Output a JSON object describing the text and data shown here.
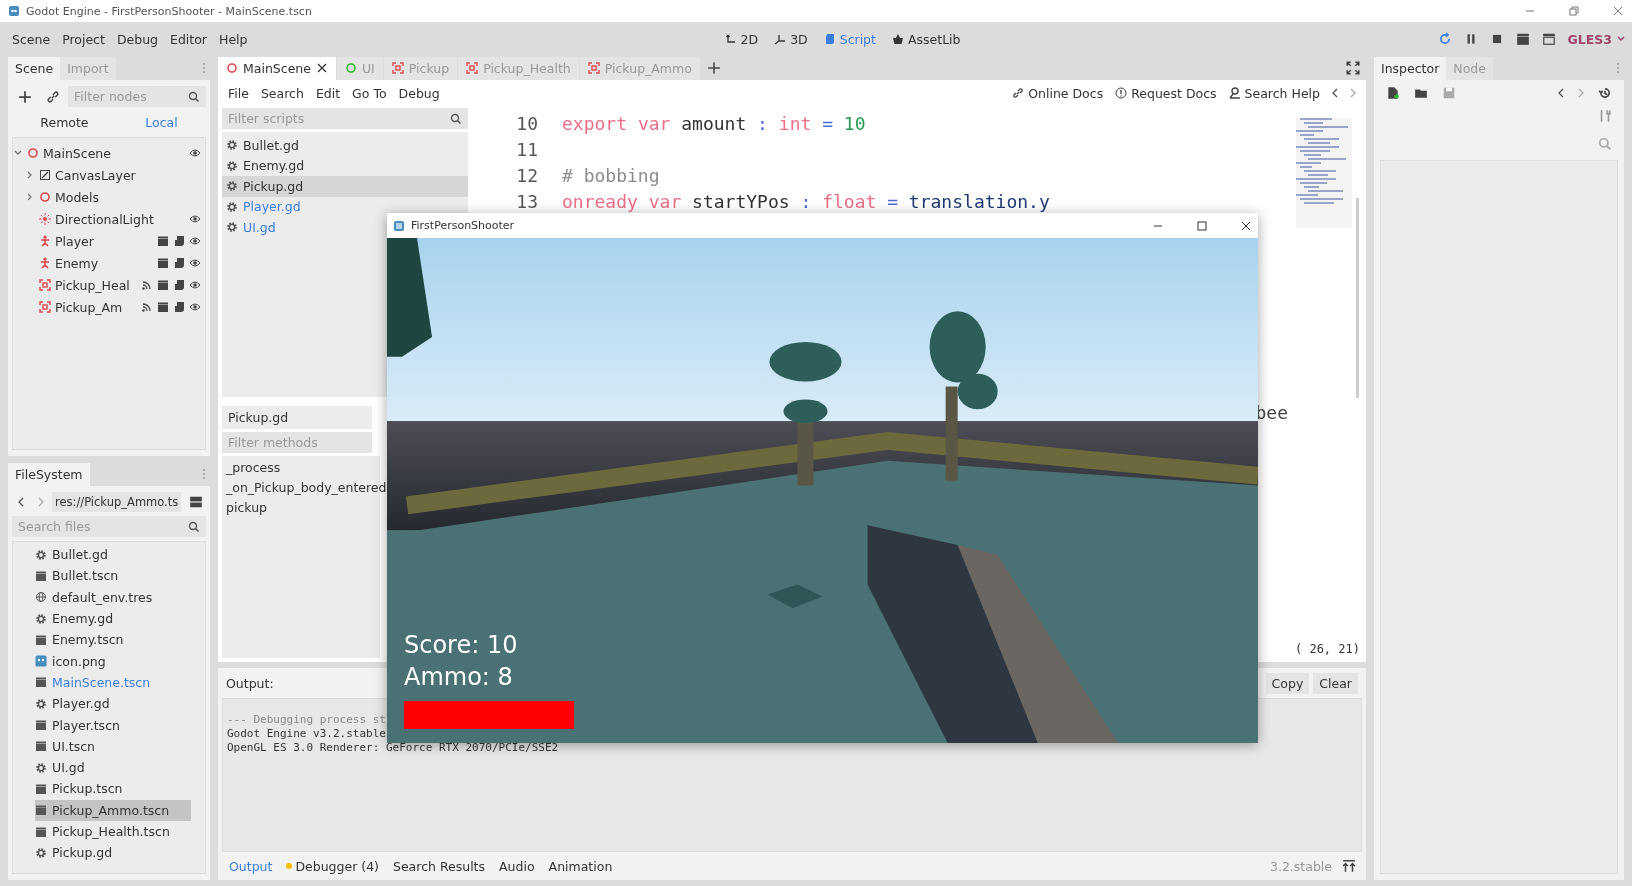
{
  "window": {
    "title": "Godot Engine - FirstPersonShooter - MainScene.tscn"
  },
  "menu": [
    "Scene",
    "Project",
    "Debug",
    "Editor",
    "Help"
  ],
  "workspaces": [
    {
      "label": "2D",
      "kind": "planar",
      "selected": false
    },
    {
      "label": "3D",
      "kind": "spatial",
      "selected": false
    },
    {
      "label": "Script",
      "kind": "script",
      "selected": true
    },
    {
      "label": "AssetLib",
      "kind": "assetlib",
      "selected": false
    }
  ],
  "renderer": "GLES3",
  "scene_dock": {
    "tabs": [
      {
        "label": "Scene",
        "selected": true
      },
      {
        "label": "Import",
        "selected": false
      }
    ],
    "filter": {
      "placeholder": "Filter nodes"
    },
    "modes": [
      {
        "label": "Remote",
        "selected": false
      },
      {
        "label": "Local",
        "selected": true
      }
    ],
    "tree": [
      {
        "name": "MainScene",
        "kind": "node3d",
        "expanded": true,
        "visible": true,
        "children": [
          {
            "name": "CanvasLayer",
            "kind": "canvas",
            "expanded": false
          },
          {
            "name": "Models",
            "kind": "node3d",
            "expanded": false
          },
          {
            "name": "DirectionalLight",
            "kind": "light",
            "visible": true
          },
          {
            "name": "Player",
            "kind": "body",
            "visible": true,
            "instanced": true,
            "script": true
          },
          {
            "name": "Enemy",
            "kind": "body",
            "visible": true,
            "instanced": true,
            "script": true
          },
          {
            "name": "Pickup_Heal",
            "kind": "area",
            "visible": true,
            "signals": true,
            "instanced": true,
            "script": true
          },
          {
            "name": "Pickup_Am",
            "kind": "area",
            "visible": true,
            "signals": true,
            "instanced": true,
            "script": true
          }
        ]
      }
    ]
  },
  "filesystem": {
    "tab": "FileSystem",
    "path": "res://Pickup_Ammo.ts",
    "search": {
      "placeholder": "Search files"
    },
    "files": [
      {
        "name": "Bullet.gd",
        "kind": "script",
        "open": false,
        "selected": false
      },
      {
        "name": "Bullet.tscn",
        "kind": "scene",
        "open": false,
        "selected": false
      },
      {
        "name": "default_env.tres",
        "kind": "env",
        "open": false,
        "selected": false
      },
      {
        "name": "Enemy.gd",
        "kind": "script",
        "open": false,
        "selected": false
      },
      {
        "name": "Enemy.tscn",
        "kind": "scene",
        "open": false,
        "selected": false
      },
      {
        "name": "icon.png",
        "kind": "image",
        "open": false,
        "selected": false
      },
      {
        "name": "MainScene.tscn",
        "kind": "scene",
        "open": true,
        "selected": false
      },
      {
        "name": "Player.gd",
        "kind": "script",
        "open": false,
        "selected": false
      },
      {
        "name": "Player.tscn",
        "kind": "scene",
        "open": false,
        "selected": false
      },
      {
        "name": "UI.tscn",
        "kind": "scene",
        "open": false,
        "selected": false
      },
      {
        "name": "UI.gd",
        "kind": "script",
        "open": false,
        "selected": false
      },
      {
        "name": "Pickup.tscn",
        "kind": "scene",
        "open": false,
        "selected": false
      },
      {
        "name": "Pickup_Ammo.tscn",
        "kind": "scene",
        "open": false,
        "selected": true
      },
      {
        "name": "Pickup_Health.tscn",
        "kind": "scene",
        "open": false,
        "selected": false
      },
      {
        "name": "Pickup.gd",
        "kind": "script",
        "open": false,
        "selected": false
      }
    ]
  },
  "scene_tabs": [
    {
      "label": "MainScene",
      "kind": "node3d",
      "selected": true
    },
    {
      "label": "UI",
      "kind": "control",
      "selected": false
    },
    {
      "label": "Pickup",
      "kind": "area",
      "selected": false
    },
    {
      "label": "Pickup_Health",
      "kind": "area",
      "selected": false
    },
    {
      "label": "Pickup_Ammo",
      "kind": "area",
      "selected": false
    }
  ],
  "script_menu": [
    "File",
    "Search",
    "Edit",
    "Go To",
    "Debug"
  ],
  "help_links": [
    {
      "label": "Online Docs",
      "kind": "link"
    },
    {
      "label": "Request Docs",
      "kind": "request"
    },
    {
      "label": "Search Help",
      "kind": "help"
    }
  ],
  "scripts": {
    "filter": {
      "placeholder": "Filter scripts"
    },
    "items": [
      {
        "name": "Bullet.gd",
        "open": false,
        "selected": false
      },
      {
        "name": "Enemy.gd",
        "open": false,
        "selected": false
      },
      {
        "name": "Pickup.gd",
        "open": false,
        "selected": true
      },
      {
        "name": "Player.gd",
        "open": true,
        "selected": false
      },
      {
        "name": "UI.gd",
        "open": true,
        "selected": false
      }
    ],
    "current": "Pickup.gd",
    "methods_filter": {
      "placeholder": "Filter methods"
    },
    "methods": [
      "_process",
      "_on_Pickup_body_entered",
      "pickup"
    ]
  },
  "code": {
    "lines": [
      {
        "number": "10",
        "tokens": [
          {
            "text": "export",
            "kind": "keyword"
          },
          {
            "text": "var",
            "kind": "keyword"
          },
          {
            "text": "amount",
            "kind": "name"
          },
          {
            "text": ":",
            "kind": "symbol"
          },
          {
            "text": "int",
            "kind": "keyword"
          },
          {
            "text": "=",
            "kind": "symbol"
          },
          {
            "text": "10",
            "kind": "number"
          }
        ]
      },
      {
        "number": "11"
      },
      {
        "number": "12",
        "tokens": [
          {
            "text": "# bobbing",
            "kind": "comment"
          }
        ]
      },
      {
        "number": "13",
        "tokens": [
          {
            "text": "onready",
            "kind": "keyword"
          },
          {
            "text": "var",
            "kind": "keyword"
          },
          {
            "text": "startYPos",
            "kind": "name"
          },
          {
            "text": ":",
            "kind": "symbol"
          },
          {
            "text": "float",
            "kind": "keyword"
          },
          {
            "text": "=",
            "kind": "symbol"
          },
          {
            "text": "translation.y",
            "kind": "type"
          }
        ]
      }
    ],
    "fragment": "bee",
    "cursor": "( 26, 21)"
  },
  "output": {
    "title": "Output:",
    "buttons": [
      "Copy",
      "Clear"
    ],
    "lines": [
      "--- Debugging process st",
      "Godot Engine v3.2.stable",
      "OpenGL ES 3.0 Renderer: GeForce RTX 2070/PCIe/SSE2"
    ]
  },
  "bottom_tabs": [
    {
      "label": "Output",
      "selected": true,
      "badge": false
    },
    {
      "label": "Debugger (4)",
      "selected": false,
      "badge": true
    },
    {
      "label": "Search Results",
      "selected": false,
      "badge": false
    },
    {
      "label": "Audio",
      "selected": false,
      "badge": false
    },
    {
      "label": "Animation",
      "selected": false,
      "badge": false
    }
  ],
  "version": "3.2.stable",
  "inspector": {
    "tabs": [
      {
        "label": "Inspector",
        "selected": true
      },
      {
        "label": "Node",
        "selected": false
      }
    ]
  },
  "game_window": {
    "title": "FirstPersonShooter",
    "score": "Score: 10",
    "ammo": "Ammo: 8"
  }
}
